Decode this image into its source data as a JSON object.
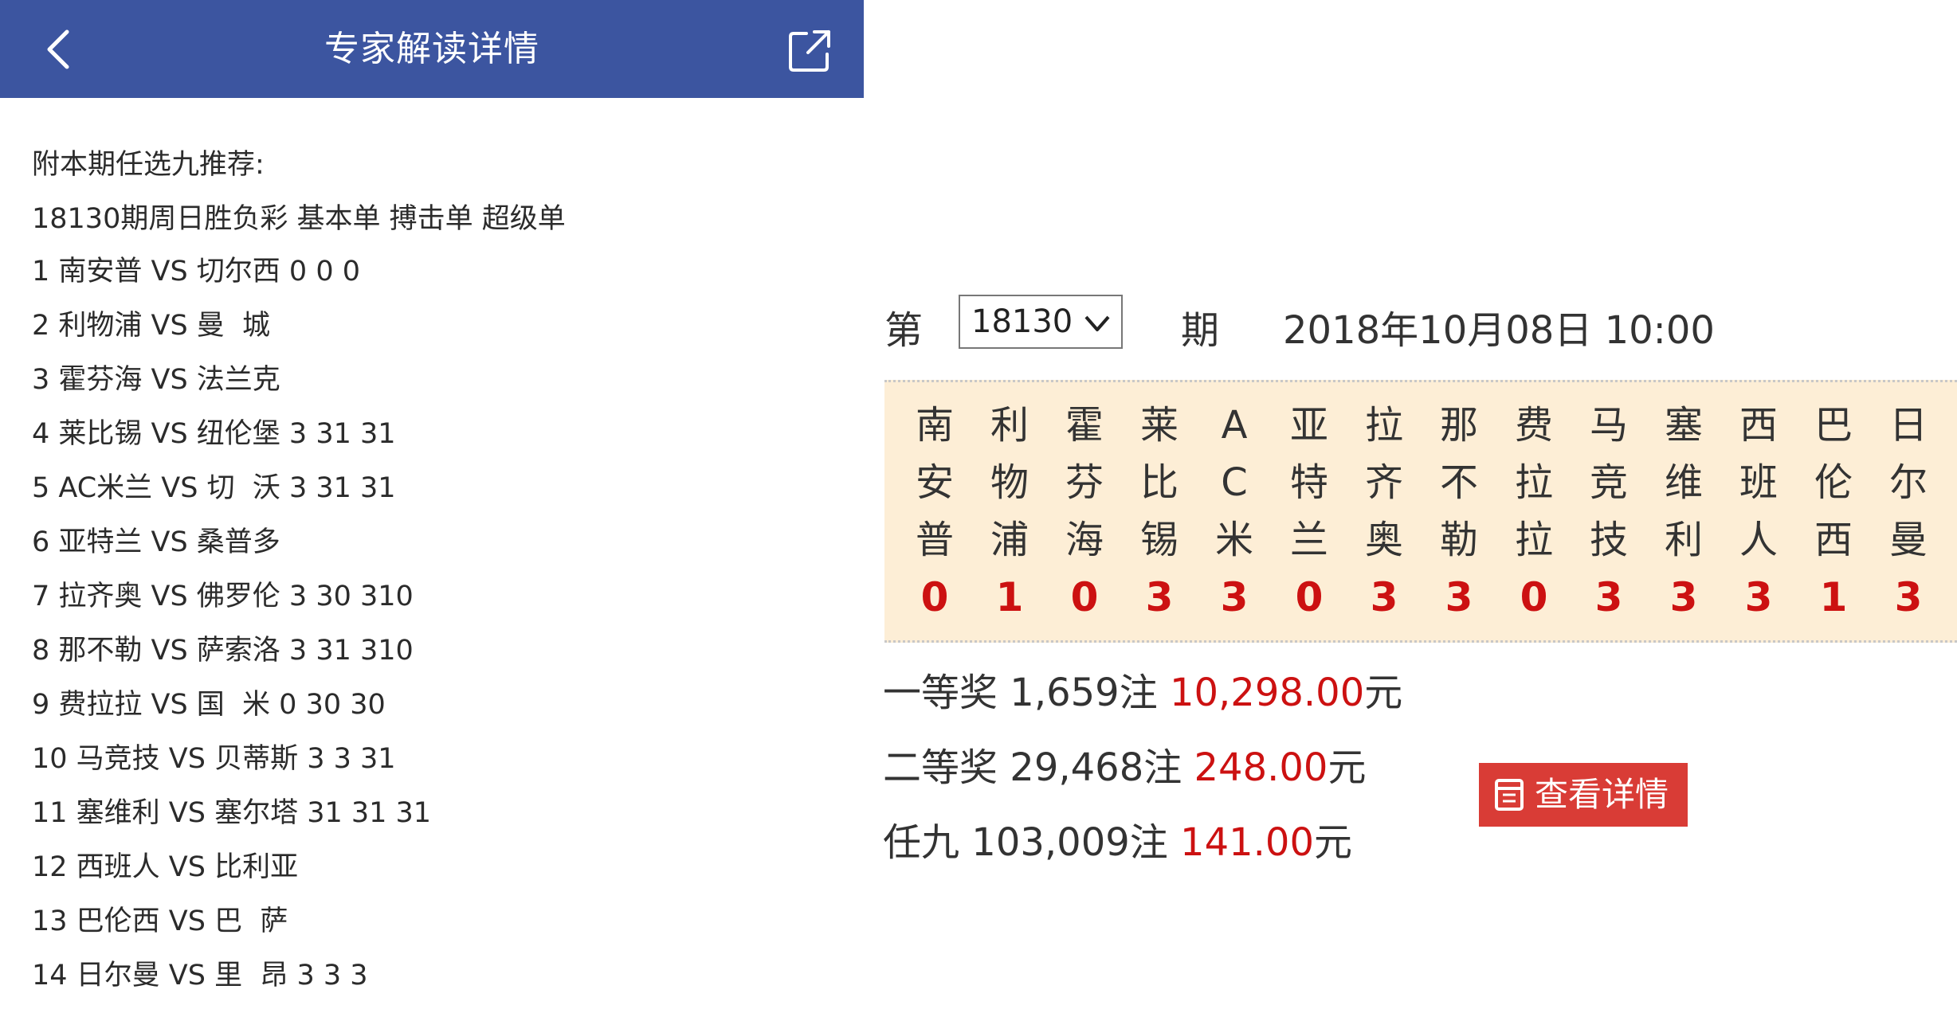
{
  "header": {
    "title": "专家解读详情"
  },
  "intro": {
    "line1": "附本期任选九推荐:",
    "line2": "18130期周日胜负彩 基本单 搏击单 超级单"
  },
  "picks": [
    "1 南安普 VS 切尔西 0 0 0",
    "2 利物浦 VS 曼  城",
    "3 霍芬海 VS 法兰克",
    "4 莱比锡 VS 纽伦堡 3 31 31",
    "5 AC米兰 VS 切  沃 3 31 31",
    "6 亚特兰 VS 桑普多",
    "7 拉齐奥 VS 佛罗伦 3 30 310",
    "8 那不勒 VS 萨索洛 3 31 310",
    "9 费拉拉 VS 国  米 0 30 30",
    "10 马竞技 VS 贝蒂斯 3 3 31",
    "11 塞维利 VS 塞尔塔 31 31 31",
    "12 西班人 VS 比利亚",
    "13 巴伦西 VS 巴  萨",
    "14 日尔曼 VS 里  昂 3 3 3"
  ],
  "draw": {
    "prefix": "第",
    "period": "18130",
    "suffix": "期",
    "datetime": "2018年10月08日 10:00",
    "teams": [
      [
        "南",
        "安",
        "普"
      ],
      [
        "利",
        "物",
        "浦"
      ],
      [
        "霍",
        "芬",
        "海"
      ],
      [
        "莱",
        "比",
        "锡"
      ],
      [
        "A",
        "C",
        "米"
      ],
      [
        "亚",
        "特",
        "兰"
      ],
      [
        "拉",
        "齐",
        "奥"
      ],
      [
        "那",
        "不",
        "勒"
      ],
      [
        "费",
        "拉",
        "拉"
      ],
      [
        "马",
        "竞",
        "技"
      ],
      [
        "塞",
        "维",
        "利"
      ],
      [
        "西",
        "班",
        "人"
      ],
      [
        "巴",
        "伦",
        "西"
      ],
      [
        "日",
        "尔",
        "曼"
      ]
    ],
    "results": [
      "0",
      "1",
      "0",
      "3",
      "3",
      "0",
      "3",
      "3",
      "0",
      "3",
      "3",
      "3",
      "1",
      "3"
    ],
    "accent": "#cc1111"
  },
  "prizes": [
    {
      "name": "一等奖",
      "count": "1,659注",
      "amount": "10,298.00",
      "unit": "元"
    },
    {
      "name": "二等奖",
      "count": "29,468注",
      "amount": "248.00",
      "unit": "元"
    },
    {
      "name": "任九",
      "count": "103,009注",
      "amount": "141.00",
      "unit": "元"
    }
  ],
  "detail_button": {
    "label": "查看详情",
    "icon": "receipt-icon"
  },
  "colors": {
    "header": "#3c55a0",
    "grid_bg": "#fdeed6",
    "button": "#d93c36"
  }
}
